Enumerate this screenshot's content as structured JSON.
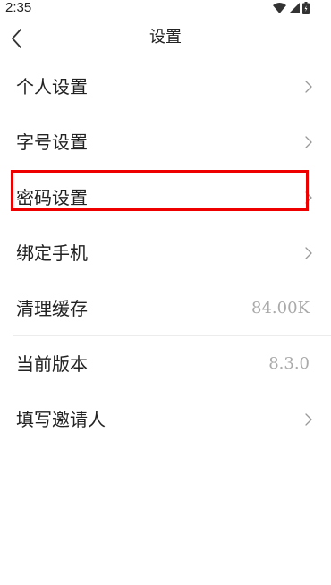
{
  "status_bar": {
    "time": "2:35",
    "icons": [
      "wifi-icon",
      "cellular-signal-icon",
      "battery-icon"
    ]
  },
  "header": {
    "title": "设置",
    "back_icon": "chevron-left-icon"
  },
  "settings": {
    "items": [
      {
        "label": "个人设置",
        "accessory": "chevron"
      },
      {
        "label": "字号设置",
        "accessory": "chevron"
      },
      {
        "label": "密码设置",
        "accessory": "chevron"
      },
      {
        "label": "绑定手机",
        "accessory": "chevron"
      },
      {
        "label": "清理缓存",
        "value": "84.00K"
      },
      {
        "label": "当前版本",
        "value": "8.3.0"
      },
      {
        "label": "填写邀请人",
        "accessory": "chevron"
      }
    ]
  },
  "colors": {
    "text": "#222222",
    "value_text": "#aaaaaa",
    "chevron": "#999999",
    "divider": "#ececec",
    "highlight": "#ee0000",
    "background": "#ffffff"
  }
}
